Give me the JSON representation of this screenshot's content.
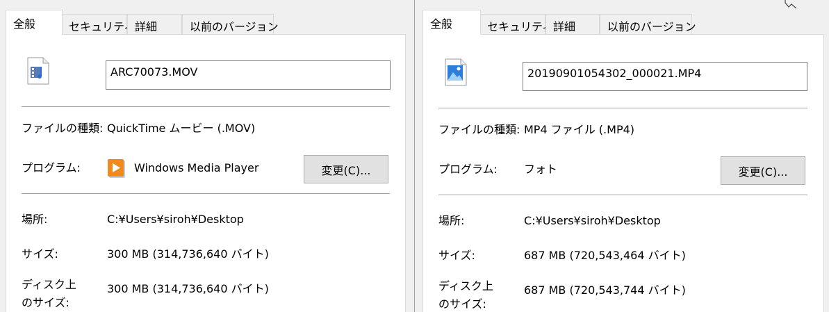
{
  "dialogs": [
    {
      "tabs": [
        {
          "label": "全般",
          "active": true
        },
        {
          "label": "セキュリティ",
          "active": false
        },
        {
          "label": "詳細",
          "active": false
        },
        {
          "label": "以前のバージョン",
          "active": false
        }
      ],
      "filename": "ARC70073.MOV",
      "file_icon": "video-audio-file-icon",
      "rows": {
        "type_label": "ファイルの種類:",
        "type_value": "QuickTime ムービー (.MOV)",
        "program_label": "プログラム:",
        "program_value": "Windows Media Player",
        "program_icon": "windows-media-player-icon",
        "change_label": "変更(C)...",
        "location_label": "場所:",
        "location_value": "C:¥Users¥siroh¥Desktop",
        "size_label": "サイズ:",
        "size_value": "300 MB (314,736,640 バイト)",
        "disk_label_1": "ディスク上",
        "disk_label_2": "のサイズ:",
        "disk_value": "300 MB (314,736,640 バイト)"
      }
    },
    {
      "tabs": [
        {
          "label": "全般",
          "active": true
        },
        {
          "label": "セキュリティ",
          "active": false
        },
        {
          "label": "詳細",
          "active": false
        },
        {
          "label": "以前のバージョン",
          "active": false
        }
      ],
      "filename": "20190901054302_000021.MP4",
      "file_icon": "image-file-icon",
      "rows": {
        "type_label": "ファイルの種類:",
        "type_value": "MP4 ファイル (.MP4)",
        "program_label": "プログラム:",
        "program_value": "フォト",
        "change_label": "変更(C)...",
        "location_label": "場所:",
        "location_value": "C:¥Users¥siroh¥Desktop",
        "size_label": "サイズ:",
        "size_value": "687 MB (720,543,464 バイト)",
        "disk_label_1": "ディスク上",
        "disk_label_2": "のサイズ:",
        "disk_value": "687 MB (720,543,744 バイト)"
      }
    }
  ]
}
